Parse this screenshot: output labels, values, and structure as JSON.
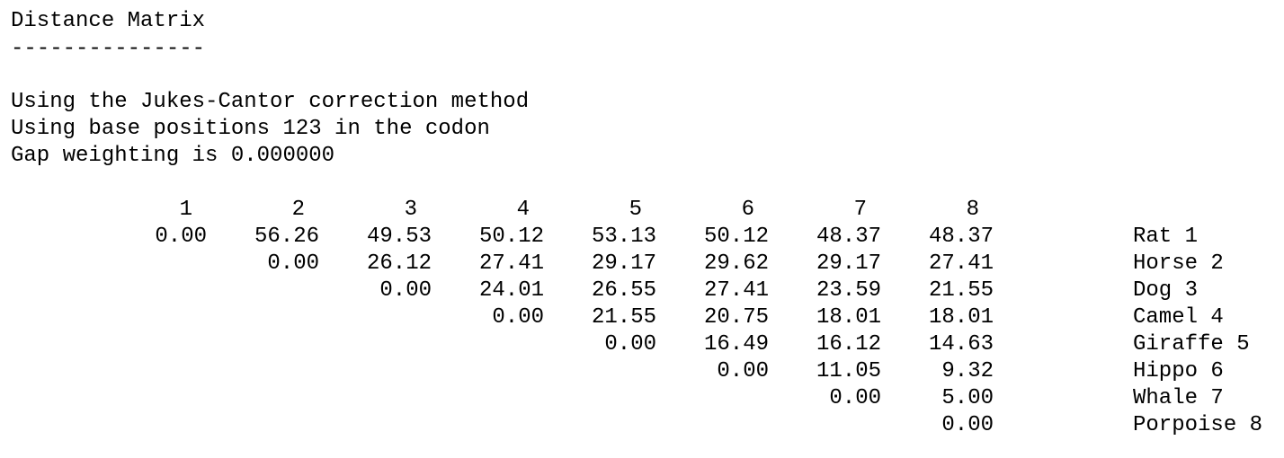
{
  "title": "Distance Matrix",
  "underline": "---------------",
  "info": [
    "Using the Jukes-Cantor correction method",
    "Using base positions 123 in the codon",
    "Gap weighting is 0.000000"
  ],
  "column_headers": [
    "1",
    "2",
    "3",
    "4",
    "5",
    "6",
    "7",
    "8"
  ],
  "rows": [
    {
      "label": "Rat 1",
      "values": [
        "0.00",
        "56.26",
        "49.53",
        "50.12",
        "53.13",
        "50.12",
        "48.37",
        "48.37"
      ]
    },
    {
      "label": "Horse 2",
      "values": [
        "0.00",
        "26.12",
        "27.41",
        "29.17",
        "29.62",
        "29.17",
        "27.41"
      ]
    },
    {
      "label": "Dog 3",
      "values": [
        "0.00",
        "24.01",
        "26.55",
        "27.41",
        "23.59",
        "21.55"
      ]
    },
    {
      "label": "Camel 4",
      "values": [
        "0.00",
        "21.55",
        "20.75",
        "18.01",
        "18.01"
      ]
    },
    {
      "label": "Giraffe 5",
      "values": [
        "0.00",
        "16.49",
        "16.12",
        "14.63"
      ]
    },
    {
      "label": "Hippo 6",
      "values": [
        "0.00",
        "11.05",
        "9.32"
      ]
    },
    {
      "label": "Whale 7",
      "values": [
        "0.00",
        "5.00"
      ]
    },
    {
      "label": "Porpoise 8",
      "values": [
        "0.00"
      ]
    }
  ]
}
